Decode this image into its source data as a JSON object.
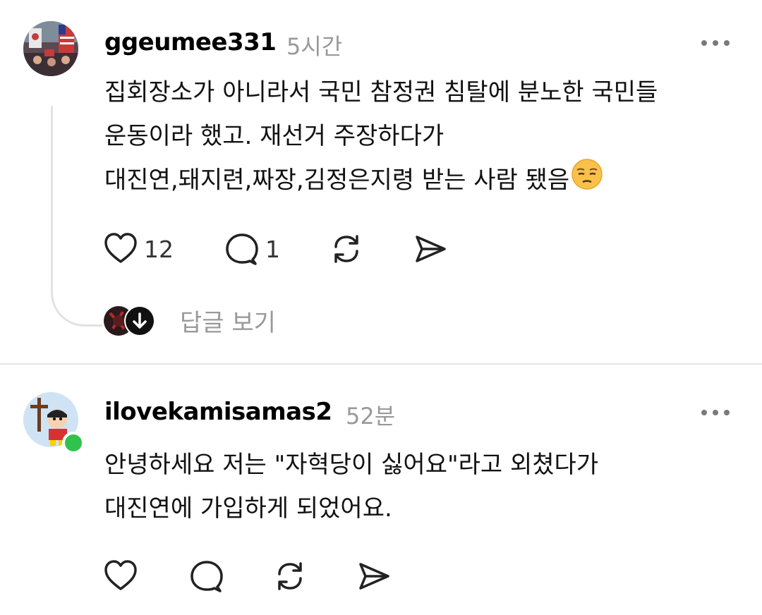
{
  "comments": [
    {
      "username": "ggeumee331",
      "time": "5시간",
      "lines": [
        "집회장소가 아니라서 국민 참정권 침탈에 분노한 국민들",
        "운동이라 했고. 재선거 주장하다가",
        "대진연,돼지련,짜장,김정은지령 받는 사람 됐음"
      ],
      "emoji": "pensive-face",
      "likes": "12",
      "replies": "1",
      "view_replies": "답글 보기"
    },
    {
      "username": "ilovekamisamas2",
      "time": "52분",
      "lines": [
        "안녕하세요 저는 \"자혁당이 싫어요\"라고 외쳤다가",
        "대진연에 가입하게 되었어요."
      ],
      "online": true
    }
  ],
  "icons": [
    "heart-icon",
    "comment-icon",
    "repost-icon",
    "share-icon",
    "more-icon",
    "chevron-down-icon"
  ],
  "colors": {
    "muted": "#999999",
    "online": "#2fc34d",
    "divider": "#e5e5e5"
  }
}
